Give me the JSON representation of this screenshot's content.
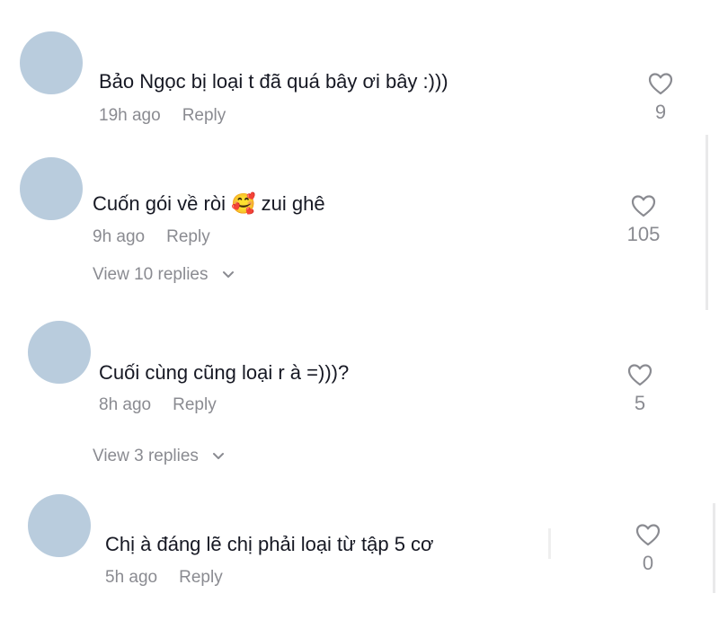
{
  "comments": [
    {
      "text": "Bảo Ngọc bị loại t đã quá bây ơi bây :)))",
      "time": "19h ago",
      "reply": "Reply",
      "likes": "9"
    },
    {
      "text_before": "Cuốn gói về ròi",
      "emoji": "🥰",
      "text_after": "zui ghê",
      "time": "9h ago",
      "reply": "Reply",
      "likes": "105",
      "view_replies": "View 10 replies"
    },
    {
      "text": "Cuối cùng cũng loại r à =)))?",
      "time": "8h ago",
      "reply": "Reply",
      "likes": "5",
      "view_replies": "View 3 replies"
    },
    {
      "text": "Chị à đáng lẽ chị phải loại từ tập 5 cơ",
      "time": "5h ago",
      "reply": "Reply",
      "likes": "0"
    }
  ],
  "colors": {
    "avatar": "#b9ccdd",
    "secondary_text": "#8a8b91",
    "primary_text": "#161823"
  }
}
